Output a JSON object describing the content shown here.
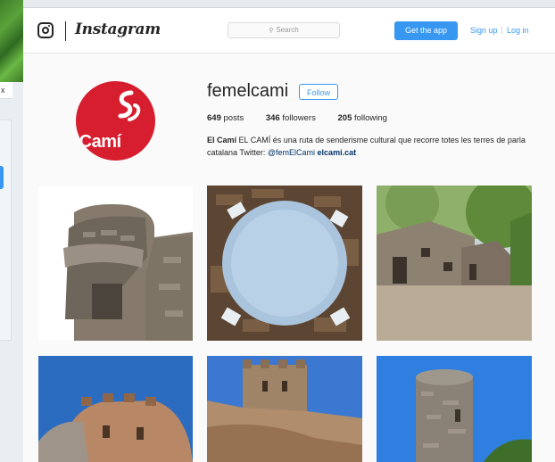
{
  "background_window": {
    "close_label": "x"
  },
  "nav": {
    "brand": "Instagram",
    "search_placeholder": "Search",
    "get_app": "Get the app",
    "sign_up": "Sign up",
    "separator": "|",
    "log_in": "Log in"
  },
  "profile": {
    "avatar_text": "elCamí",
    "avatar_mark": "S",
    "username": "femelcami",
    "follow_label": "Follow",
    "stats": [
      {
        "count": "649",
        "label": "posts"
      },
      {
        "count": "346",
        "label": "followers"
      },
      {
        "count": "205",
        "label": "following"
      }
    ],
    "bio": {
      "name": "El Camí",
      "text": " EL CAMÍ és una ruta de senderisme cultural que recorre totes les terres de parla catalana Twitter: ",
      "handle": "@femElCami",
      "link": "elcami.cat"
    }
  },
  "posts": [
    {
      "subject": "stone-watchtower-ruin"
    },
    {
      "subject": "tower-interior-looking-up"
    },
    {
      "subject": "stone-farmhouse"
    },
    {
      "subject": "round-fortress-tower"
    },
    {
      "subject": "hilltop-castle"
    },
    {
      "subject": "round-stone-tower"
    }
  ],
  "colors": {
    "accent": "#3897f0",
    "brand_red": "#d71e2f",
    "link_dark": "#003569"
  }
}
